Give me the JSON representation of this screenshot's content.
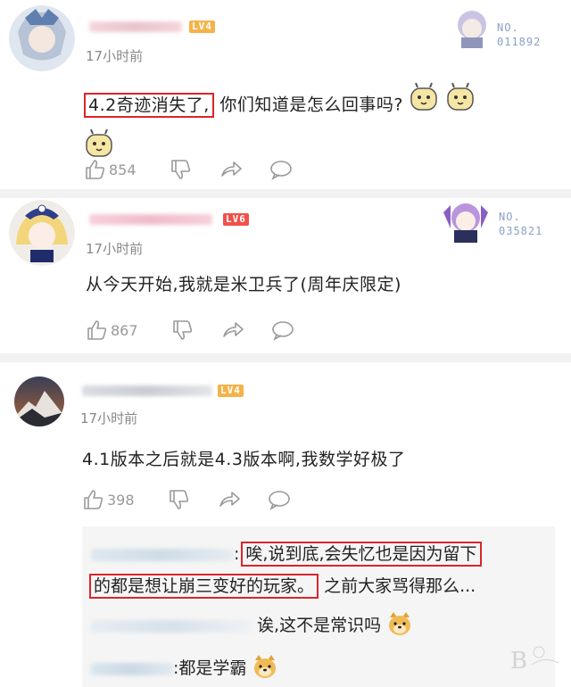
{
  "comments": [
    {
      "level": "LV4",
      "time": "17小时前",
      "highlight": "4.2奇迹消失了,",
      "text": "你们知道是怎么回事吗?",
      "likes": "854",
      "badge_no": "NO.",
      "badge_num": "011892"
    },
    {
      "level": "LV6",
      "time": "17小时前",
      "text": "从今天开始,我就是米卫兵了(周年庆限定)",
      "likes": "867",
      "badge_no": "NO.",
      "badge_num": "035821"
    },
    {
      "level": "LV4",
      "time": "17小时前",
      "text": "4.1版本之后就是4.3版本啊,我数学好极了",
      "likes": "398"
    }
  ],
  "replies": [
    {
      "text_hl_1": "唉,说到底,会失忆也是因为留下",
      "text_hl_2": "的都是想让崩三变好的玩家。",
      "text_rest": "之前大家骂得那么..."
    },
    {
      "text": "诶,这不是常识吗"
    },
    {
      "prefix": ":",
      "text": "都是学霸"
    }
  ],
  "colors": {
    "highlight_border": "#d9262c",
    "lv4": "#f6b24a",
    "lv6": "#f0514a"
  },
  "icons": [
    "thumb-up-icon",
    "thumb-down-icon",
    "share-icon",
    "comment-icon"
  ]
}
